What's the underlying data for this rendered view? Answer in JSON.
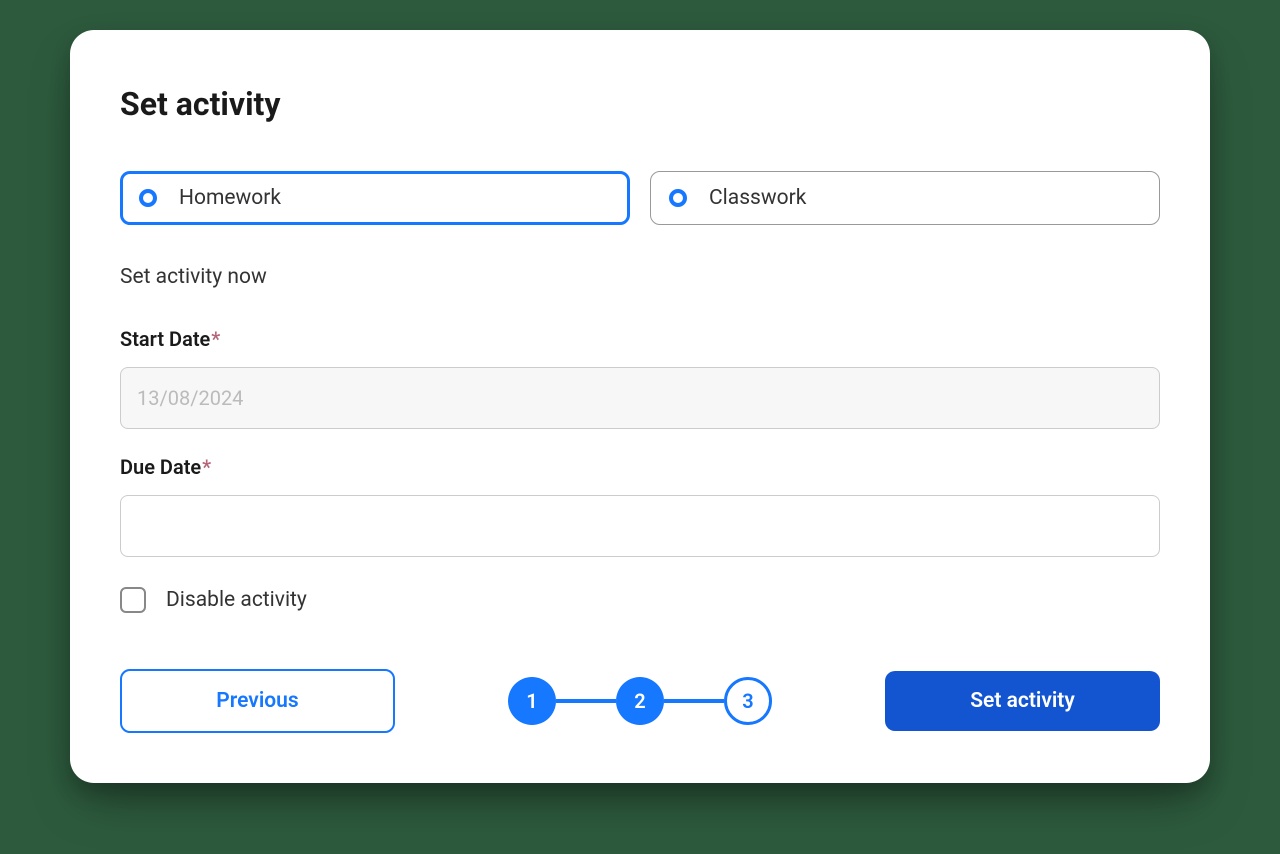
{
  "title": "Set activity",
  "options": {
    "homework": "Homework",
    "classwork": "Classwork"
  },
  "subtitle": "Set activity now",
  "fields": {
    "start_date_label": "Start Date",
    "start_date_value": "13/08/2024",
    "due_date_label": "Due Date",
    "due_date_value": "",
    "required_marker": "*"
  },
  "checkbox": {
    "label": "Disable activity"
  },
  "footer": {
    "previous_label": "Previous",
    "submit_label": "Set activity"
  },
  "stepper": {
    "step1": "1",
    "step2": "2",
    "step3": "3"
  }
}
